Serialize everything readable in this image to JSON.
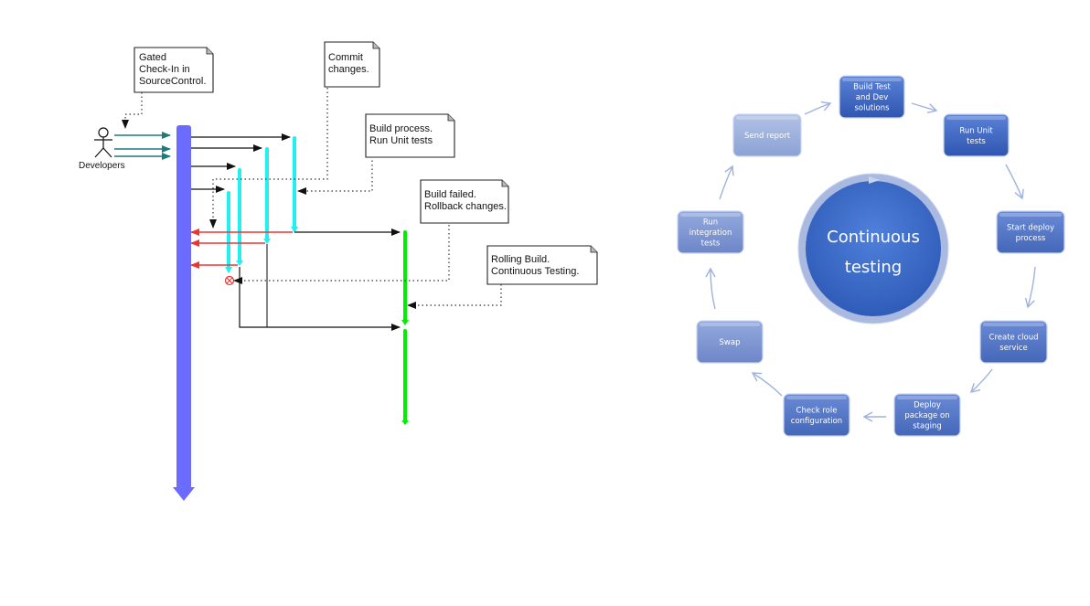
{
  "left_diagram": {
    "actor": {
      "label": "Developers",
      "icon": "stick-figure-icon"
    },
    "notes": [
      {
        "id": "gated-checkin",
        "lines": [
          "Gated",
          "Check-In in",
          "SourceControl."
        ]
      },
      {
        "id": "commit",
        "lines": [
          "Commit",
          "changes."
        ]
      },
      {
        "id": "build-process",
        "lines": [
          "Build process.",
          "Run Unit tests"
        ]
      },
      {
        "id": "build-failed",
        "lines": [
          "Build failed.",
          "Rollback changes."
        ]
      },
      {
        "id": "rolling-build",
        "lines": [
          "Rolling Build.",
          "Continuous Testing."
        ]
      }
    ],
    "failure_marker": {
      "icon": "circle-x-icon"
    },
    "colors": {
      "timeline": "#6b6bff",
      "build_lane": "#22f0f0",
      "success_lane": "#00ee00",
      "rollback_arrow": "#ee3333",
      "checkin_arrow": "#1f7a7a",
      "flow_arrow": "#111111"
    }
  },
  "right_diagram": {
    "hub": {
      "lines": [
        "Continuous",
        "testing"
      ]
    },
    "steps": [
      {
        "id": "build-test-dev",
        "lines": [
          "Build Test",
          "and Dev",
          "solutions"
        ],
        "shade": "dark"
      },
      {
        "id": "run-unit-tests",
        "lines": [
          "Run Unit",
          "tests"
        ],
        "shade": "dark"
      },
      {
        "id": "start-deploy",
        "lines": [
          "Start deploy",
          "process"
        ],
        "shade": "mid"
      },
      {
        "id": "create-cloud-service",
        "lines": [
          "Create cloud",
          "service"
        ],
        "shade": "mid"
      },
      {
        "id": "deploy-package",
        "lines": [
          "Deploy",
          "package on",
          "staging"
        ],
        "shade": "mid"
      },
      {
        "id": "check-role-config",
        "lines": [
          "Check role",
          "configuration"
        ],
        "shade": "mid"
      },
      {
        "id": "swap",
        "lines": [
          "Swap"
        ],
        "shade": "light"
      },
      {
        "id": "run-integration-tests",
        "lines": [
          "Run",
          "integration",
          "tests"
        ],
        "shade": "light"
      },
      {
        "id": "send-report",
        "lines": [
          "Send report"
        ],
        "shade": "lighter"
      }
    ],
    "colors": {
      "dark": "#3f66c4",
      "mid": "#5276c8",
      "light": "#7a94d2",
      "lighter": "#98aedb",
      "hub": "#3d6cc9",
      "hub_ring": "#a9b9e0",
      "arrow": "#9fb2de"
    }
  }
}
